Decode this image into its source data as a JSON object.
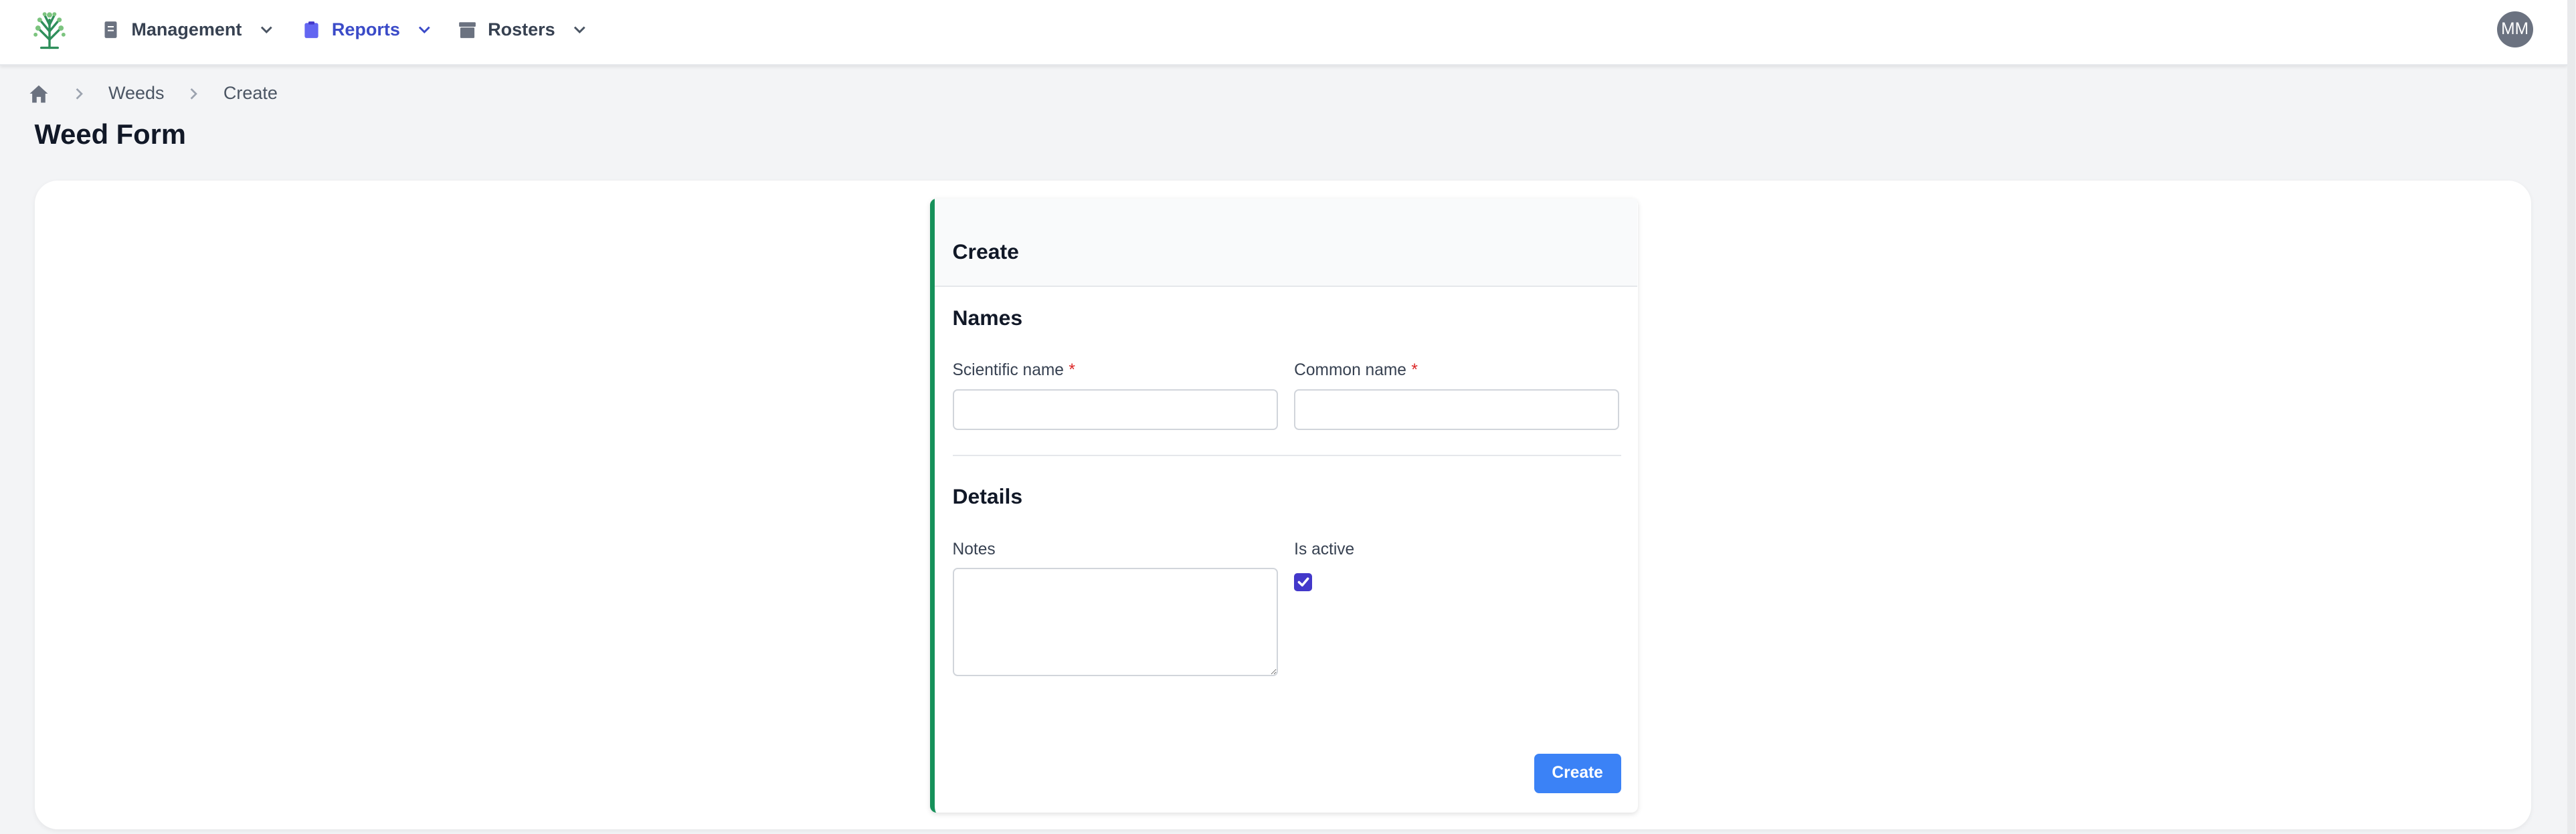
{
  "nav": {
    "items": [
      {
        "label": "Management",
        "icon": "document-icon",
        "active": false
      },
      {
        "label": "Reports",
        "icon": "clipboard-icon",
        "active": true
      },
      {
        "label": "Rosters",
        "icon": "archive-icon",
        "active": false
      }
    ],
    "avatar_initials": "MM",
    "active_color": "#3b4bc8"
  },
  "breadcrumb": {
    "items": [
      "Weeds",
      "Create"
    ]
  },
  "page": {
    "title": "Weed Form"
  },
  "form": {
    "header_title": "Create",
    "accent_color": "#16915a",
    "sections": {
      "names": {
        "title": "Names",
        "scientific_label": "Scientific name",
        "scientific_value": "",
        "common_label": "Common name",
        "common_value": "",
        "required_marker": "*"
      },
      "details": {
        "title": "Details",
        "notes_label": "Notes",
        "notes_value": "",
        "active_label": "Is active",
        "active_checked": true
      }
    },
    "submit_label": "Create",
    "submit_color": "#3b82f6"
  }
}
